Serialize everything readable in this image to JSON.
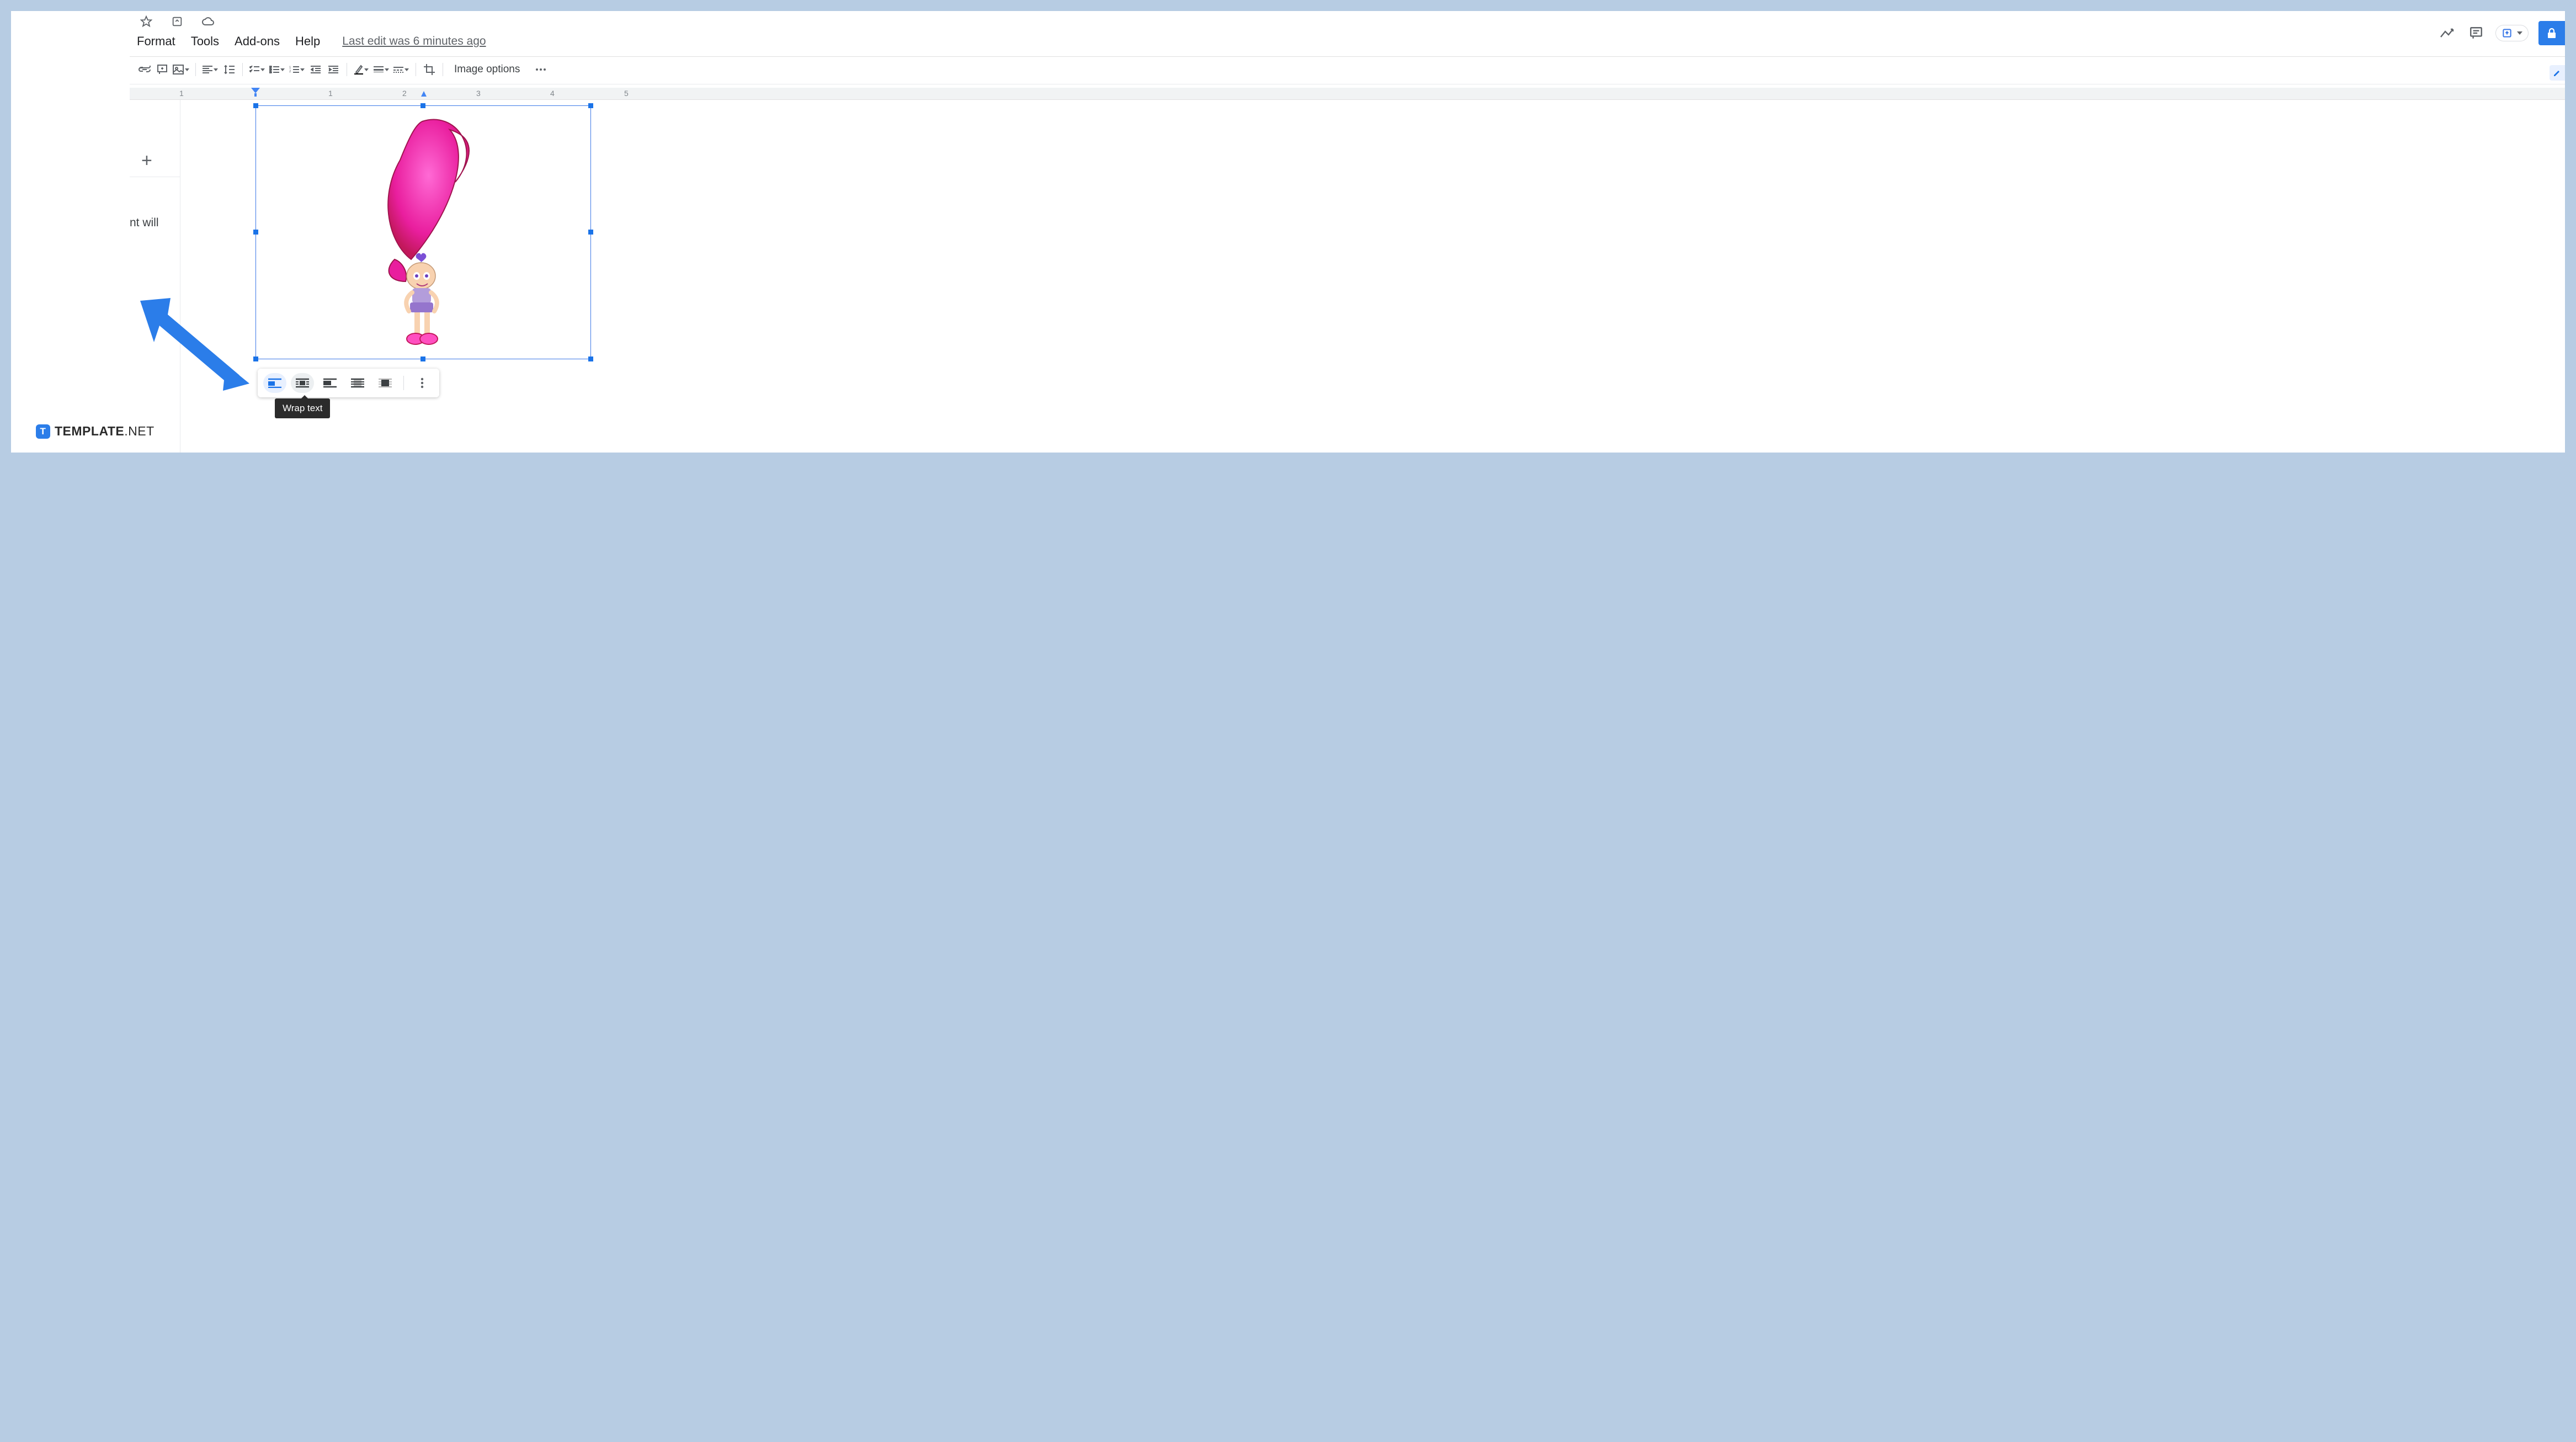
{
  "menu": {
    "format": "Format",
    "tools": "Tools",
    "addons": "Add-ons",
    "help": "Help",
    "edit_status": "Last edit was 6 minutes ago"
  },
  "toolbar": {
    "image_options": "Image options"
  },
  "ruler": {
    "n1": "1",
    "n2": "1",
    "n3": "2",
    "n4": "3",
    "n5": "4",
    "n6": "5"
  },
  "outline": {
    "text_fragment": "nt will"
  },
  "tooltip": {
    "wrap_text": "Wrap text"
  },
  "watermark": {
    "brand": "TEMPLATE",
    "suffix": ".NET"
  },
  "icons": {
    "star": "star-icon",
    "move": "move-icon",
    "cloud": "cloud-icon",
    "activity": "activity-icon",
    "comment": "comment-icon",
    "present": "present-icon",
    "lock": "lock-icon"
  }
}
